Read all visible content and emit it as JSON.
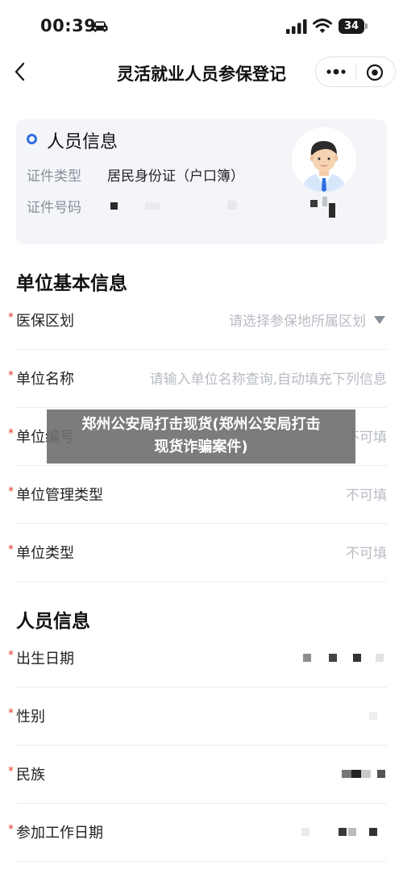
{
  "status_bar": {
    "time": "00:39",
    "battery": "34"
  },
  "nav": {
    "title": "灵活就业人员参保登记"
  },
  "person_card": {
    "title": "人员信息",
    "id_type_label": "证件类型",
    "id_type_value": "居民身份证（户口簿）",
    "id_number_label": "证件号码"
  },
  "unit_section": {
    "title": "单位基本信息",
    "rows": [
      {
        "label": "医保区划",
        "value": "请选择参保地所属区划"
      },
      {
        "label": "单位名称",
        "value": "请输入单位名称查询,自动填充下列信息"
      },
      {
        "label": "单位编号",
        "value": "不可填"
      },
      {
        "label": "单位管理类型",
        "value": "不可填"
      },
      {
        "label": "单位类型",
        "value": "不可填"
      }
    ]
  },
  "person_section": {
    "title": "人员信息",
    "rows": [
      {
        "label": "出生日期"
      },
      {
        "label": "性别"
      },
      {
        "label": "民族"
      },
      {
        "label": "参加工作日期"
      }
    ]
  },
  "required_mark": "*",
  "banner": {
    "line1": "郑州公安局打击现货(郑州公安局打击",
    "line2": "现货诈骗案件)"
  },
  "colors": {
    "accent": "#2f6de0",
    "required": "#e0382b",
    "placeholder": "#b8bcc4"
  }
}
